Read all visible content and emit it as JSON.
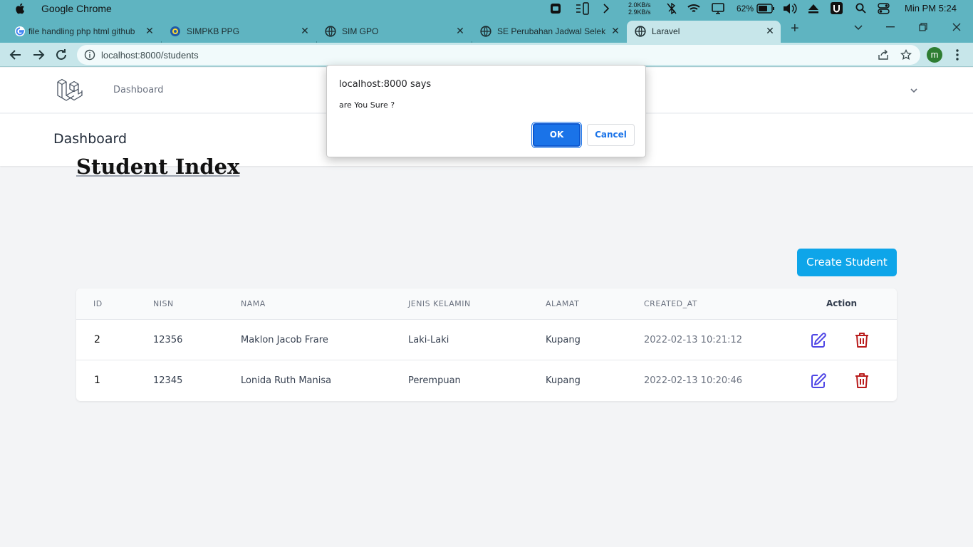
{
  "os_menubar": {
    "app_name": "Google Chrome",
    "net_up": "2.0KB/s",
    "net_down": "2.9KB/s",
    "battery": "62%",
    "clock": "Min PM 5:24"
  },
  "browser": {
    "tabs": [
      {
        "title": "file handling php html github",
        "icon": "google-icon"
      },
      {
        "title": "SIMPKB PPG",
        "icon": "simpkb-icon"
      },
      {
        "title": "SIM GPO",
        "icon": "globe-icon"
      },
      {
        "title": "SE Perubahan Jadwal Seleksi",
        "icon": "globe-icon"
      },
      {
        "title": "Laravel",
        "icon": "globe-icon",
        "active": true
      }
    ],
    "url": "localhost:8000/students",
    "profile_initial": "m"
  },
  "app": {
    "nav_link": "Dashboard",
    "header_title": "Dashboard",
    "page_title": "Student Index",
    "create_button": "Create Student",
    "table": {
      "headers": [
        "ID",
        "NISN",
        "NAMA",
        "JENIS KELAMIN",
        "ALAMAT",
        "CREATED_AT",
        "Action"
      ],
      "rows": [
        {
          "id": "2",
          "nisn": "12356",
          "nama": "Maklon Jacob Frare",
          "jenis_kelamin": "Laki-Laki",
          "alamat": "Kupang",
          "created_at": "2022-02-13 10:21:12"
        },
        {
          "id": "1",
          "nisn": "12345",
          "nama": "Lonida Ruth Manisa",
          "jenis_kelamin": "Perempuan",
          "alamat": "Kupang",
          "created_at": "2022-02-13 10:20:46"
        }
      ]
    }
  },
  "dialog": {
    "title": "localhost:8000 says",
    "message": "are You Sure ?",
    "ok_label": "OK",
    "cancel_label": "Cancel"
  },
  "colors": {
    "chrome_frame": "#5fb4c1",
    "toolbar": "#c7e6ea",
    "create_button": "#0ea5e9",
    "edit_icon": "#4f46e5",
    "delete_icon": "#b91c1c",
    "dialog_ok": "#1a73e8"
  }
}
